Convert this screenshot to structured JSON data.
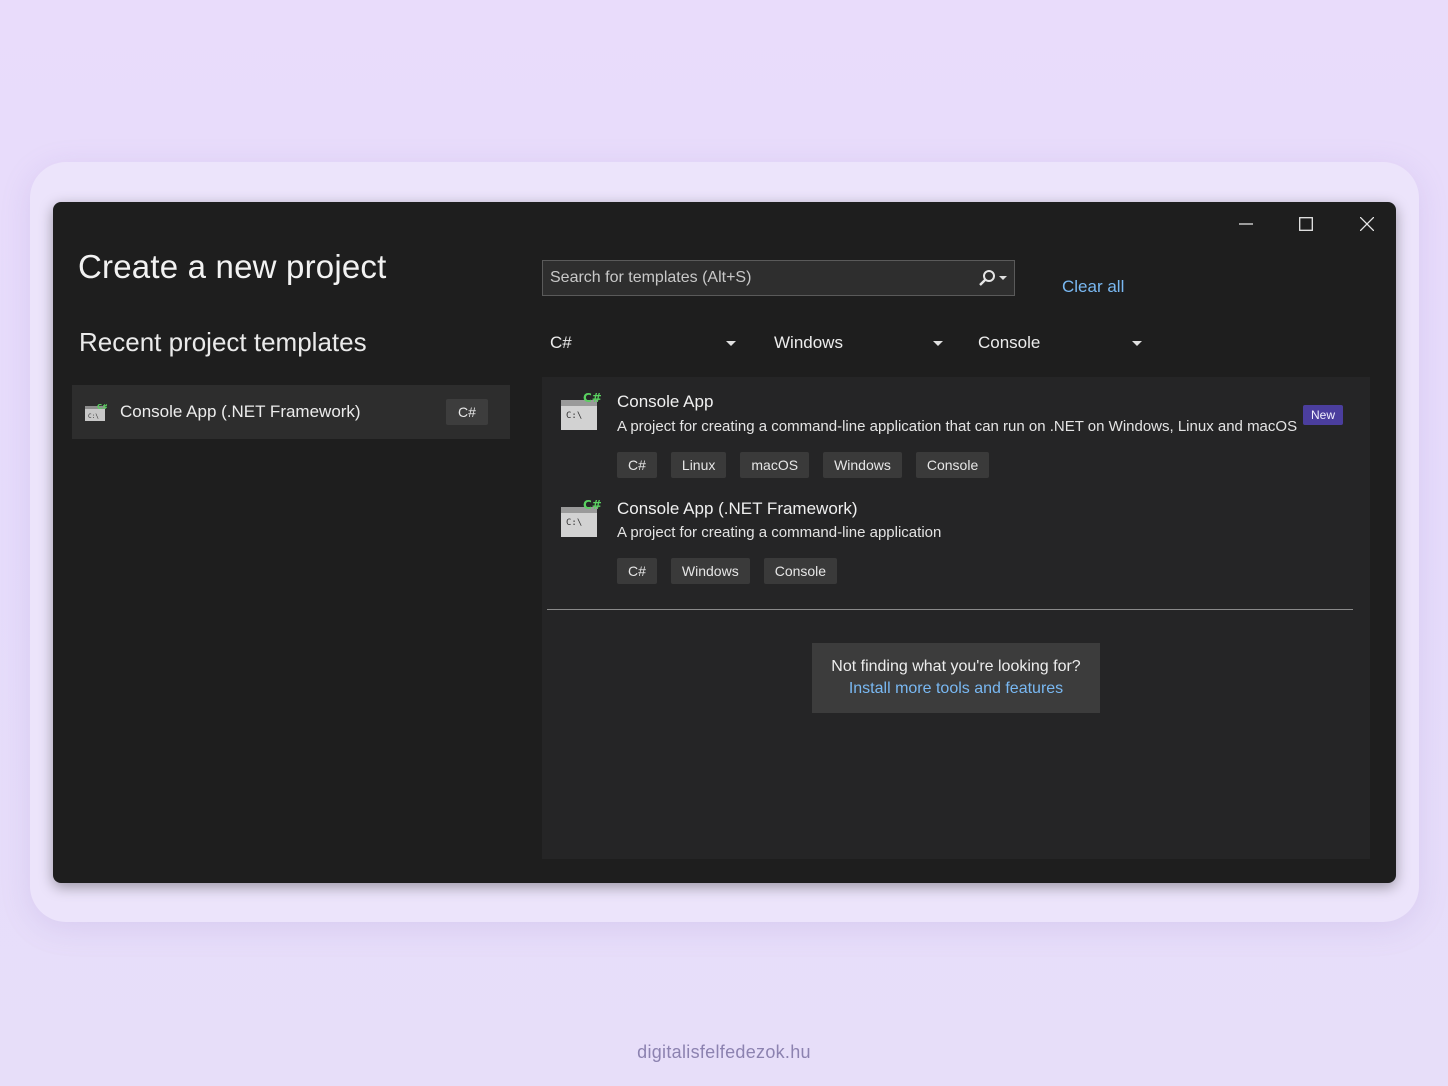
{
  "window": {
    "title": "Create a new project",
    "controls": {
      "minimize": "minimize-icon",
      "maximize": "maximize-icon",
      "close": "close-icon"
    }
  },
  "recent": {
    "heading": "Recent project templates",
    "items": [
      {
        "name": "Console App (.NET Framework)",
        "language": "C#",
        "icon": "csharp-console-icon"
      }
    ]
  },
  "search": {
    "placeholder": "Search for templates (Alt+S)",
    "value": "",
    "icon": "search-icon"
  },
  "clear_all": "Clear all",
  "filters": {
    "language": "C#",
    "platform": "Windows",
    "project_type": "Console"
  },
  "templates": [
    {
      "name": "Console App",
      "description": "A project for creating a command-line application that can run on .NET on Windows, Linux and macOS",
      "badge": "New",
      "tags": [
        "C#",
        "Linux",
        "macOS",
        "Windows",
        "Console"
      ],
      "icon": "csharp-console-icon"
    },
    {
      "name": "Console App (.NET Framework)",
      "description": "A project for creating a command-line application",
      "tags": [
        "C#",
        "Windows",
        "Console"
      ],
      "icon": "csharp-console-icon"
    }
  ],
  "not_finding": {
    "question": "Not finding what you're looking for?",
    "link": "Install more tools and features"
  },
  "footer": "digitalisfelfedezok.hu",
  "colors": {
    "window_bg": "#1e1e1e",
    "panel_bg": "#252526",
    "link": "#79b8f2",
    "badge_new": "#4b3e9e",
    "page_bg": "#e9dcfb"
  }
}
